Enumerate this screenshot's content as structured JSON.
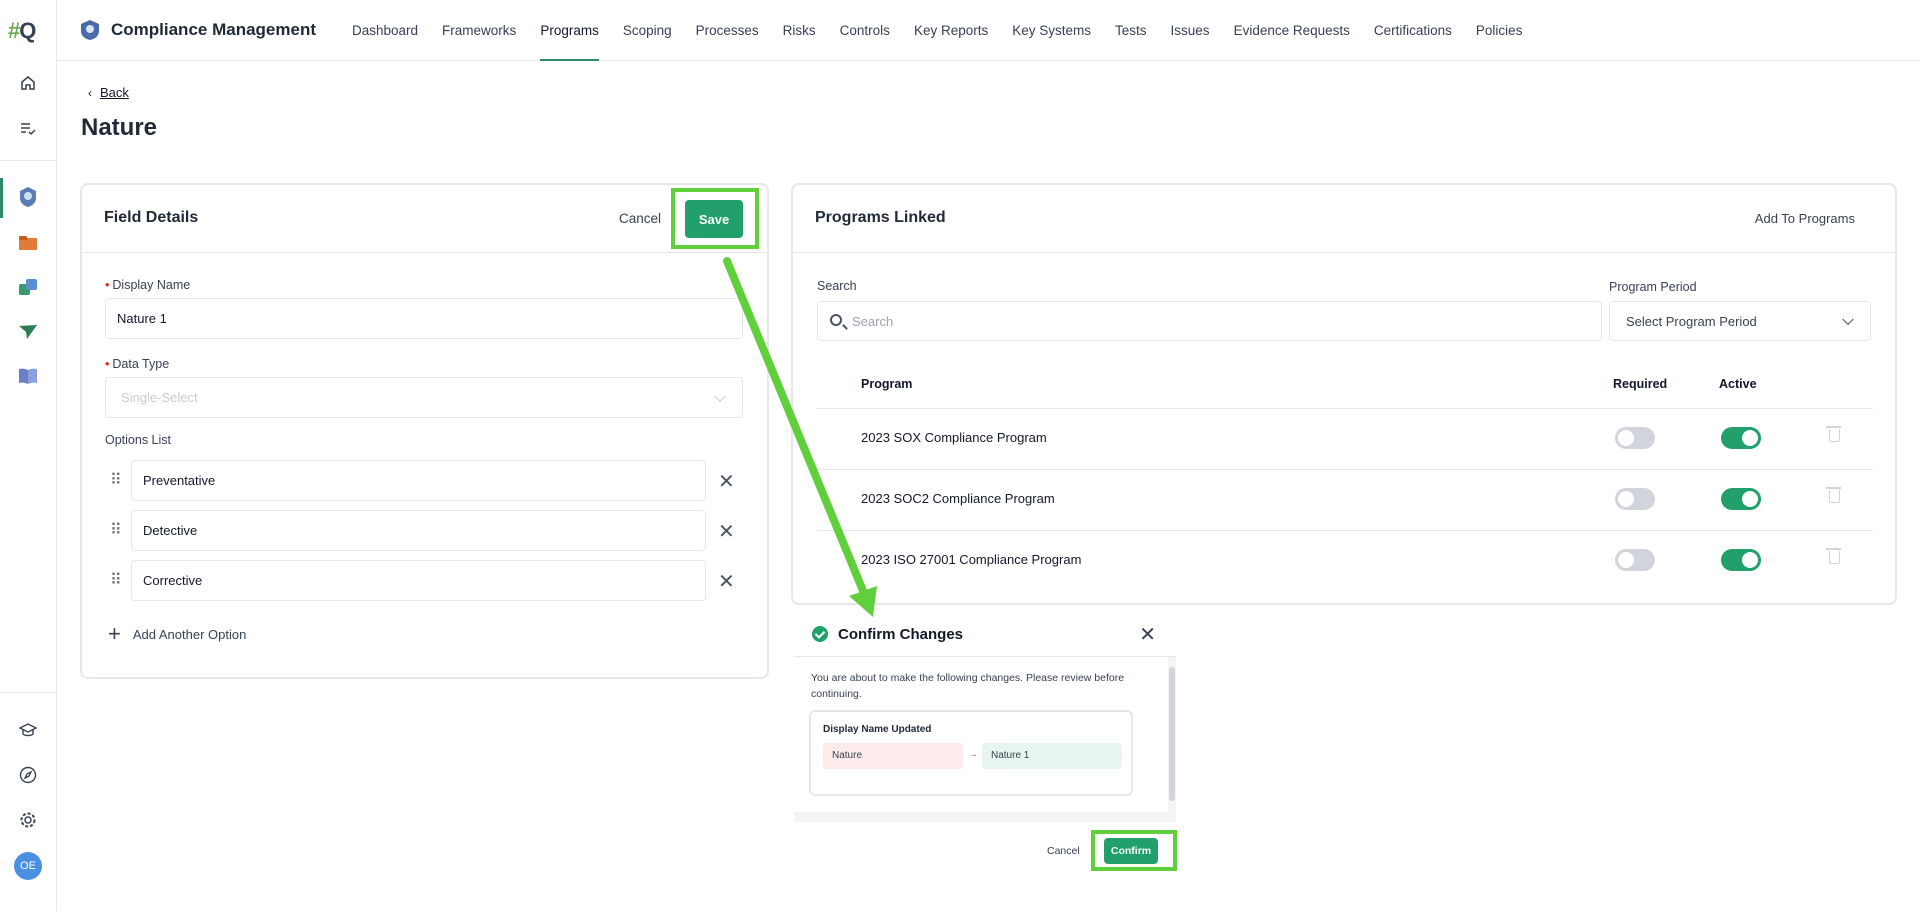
{
  "rail": {
    "logo_hash": "#",
    "logo_q": "Q",
    "avatar_initials": "OE"
  },
  "app": {
    "title": "Compliance Management"
  },
  "nav": {
    "items": [
      "Dashboard",
      "Frameworks",
      "Programs",
      "Scoping",
      "Processes",
      "Risks",
      "Controls",
      "Key Reports",
      "Key Systems",
      "Tests",
      "Issues",
      "Evidence Requests",
      "Certifications",
      "Policies"
    ],
    "active": "Programs"
  },
  "header": {
    "back_label": "Back",
    "page_title": "Nature"
  },
  "field_details": {
    "title": "Field Details",
    "cancel_label": "Cancel",
    "save_label": "Save",
    "display_name_label": "Display Name",
    "display_name_value": "Nature 1",
    "data_type_label": "Data Type",
    "data_type_value": "Single-Select",
    "options_list_label": "Options List",
    "options": [
      "Preventative",
      "Detective",
      "Corrective"
    ],
    "add_option_label": "Add Another Option"
  },
  "programs_linked": {
    "title": "Programs Linked",
    "add_label": "Add To Programs",
    "search_label": "Search",
    "search_placeholder": "Search",
    "period_label": "Program Period",
    "period_placeholder": "Select Program Period",
    "columns": [
      "Program",
      "Required",
      "Active"
    ],
    "rows": [
      {
        "name": "2023 SOX Compliance Program",
        "required": false,
        "active": true
      },
      {
        "name": "2023 SOC2 Compliance Program",
        "required": false,
        "active": true
      },
      {
        "name": "2023 ISO 27001 Compliance Program",
        "required": false,
        "active": true
      }
    ]
  },
  "confirm_dialog": {
    "title": "Confirm Changes",
    "message": "You are about to make the following changes. Please review before continuing.",
    "change_label": "Display Name Updated",
    "old_value": "Nature",
    "arrow": "→",
    "new_value": "Nature 1",
    "cancel_label": "Cancel",
    "confirm_label": "Confirm"
  },
  "colors": {
    "accent": "#22a06b",
    "highlight": "#5fd03c",
    "required_star": "#dc2626"
  }
}
